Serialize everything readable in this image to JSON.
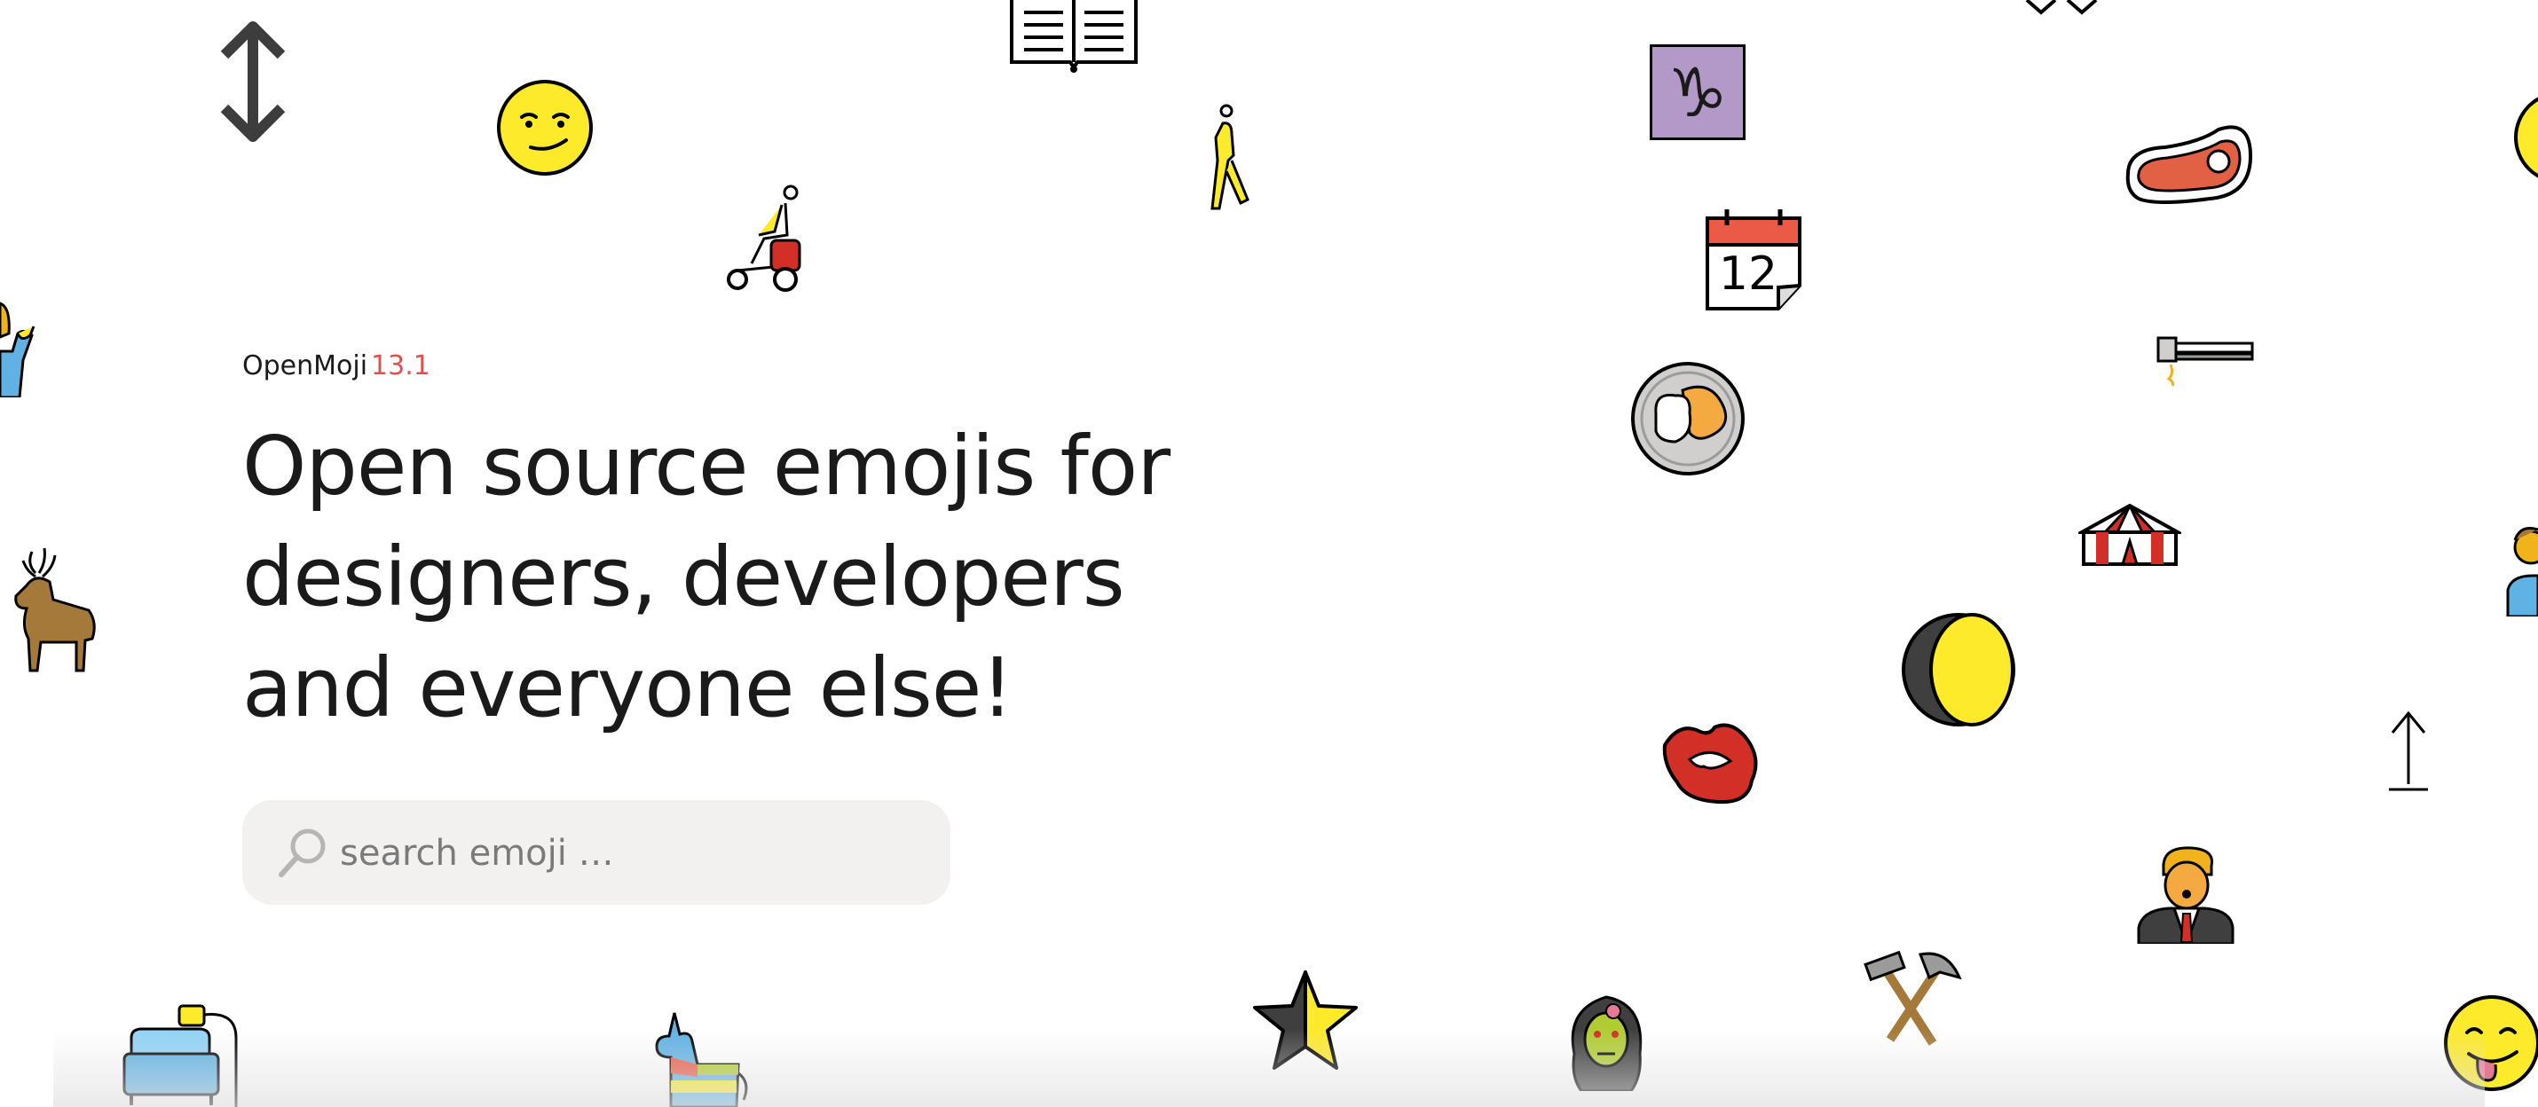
{
  "brand": {
    "name": "OpenMoji",
    "version": "13.1"
  },
  "hero": {
    "headline_lines": [
      "Open source emojis for",
      "designers, developers",
      "and everyone else!"
    ]
  },
  "search": {
    "placeholder": "search emoji …",
    "value": ""
  },
  "colors": {
    "accent": "#d9534f",
    "emoji_yellow": "#fcea2b",
    "emoji_stroke": "#000000",
    "search_bg": "#f2f1f0"
  },
  "decorative_emojis": [
    "up-down-arrow",
    "smirking-face",
    "open-book",
    "person-in-wheelchair",
    "person-walking",
    "capricorn",
    "tear-off-calendar",
    "cut-of-meat",
    "rice-and-curry",
    "garlic-press",
    "circus-tent",
    "last-quarter-moon",
    "kiss-mark",
    "up-arrow",
    "man-in-suit",
    "hammer-and-pick",
    "zombie",
    "flag-belgium-star",
    "pinata",
    "couch-and-lamp",
    "face-savoring-food",
    "deer",
    "person-raising-hand",
    "boy"
  ],
  "calendar": {
    "day": "12"
  },
  "capricorn": {
    "symbol": "♑"
  }
}
